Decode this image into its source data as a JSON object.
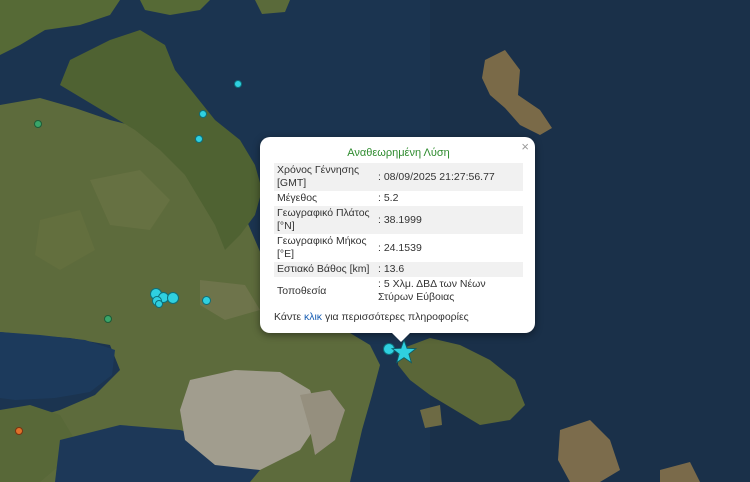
{
  "popup": {
    "title": "Αναθεωρημένη Λύση",
    "close_label": "×",
    "rows": [
      {
        "key": "Χρόνος Γέννησης [GMT]",
        "value": ": 08/09/2025 21:27:56.77"
      },
      {
        "key": "Μέγεθος",
        "value": ": 5.2"
      },
      {
        "key": "Γεωγραφικό Πλάτος [°N]",
        "value": ": 38.1999"
      },
      {
        "key": "Γεωγραφικό Μήκος [°E]",
        "value": ": 24.1539"
      },
      {
        "key": "Εστιακό Βάθος [km]",
        "value": ": 13.6"
      },
      {
        "key": "Τοποθεσία",
        "value": ": 5 Χλμ. ΔΒΔ των Νέων Στύρων Εύβοιας"
      }
    ],
    "more_prefix": "Κάντε ",
    "more_link": "κλικ",
    "more_suffix": " για περισσότερες πληροφορίες"
  },
  "colors": {
    "sea": "#1b3450",
    "land": "#5d6b3c",
    "urban": "#a19d8e",
    "epicenter": "#2fd0e0",
    "marker_cyan": "#2fd0e0",
    "marker_green": "#3aa56a",
    "marker_orange": "#e0702a"
  },
  "markers": {
    "epicenter_icon": "star-icon",
    "event_icon": "circle-icon"
  }
}
